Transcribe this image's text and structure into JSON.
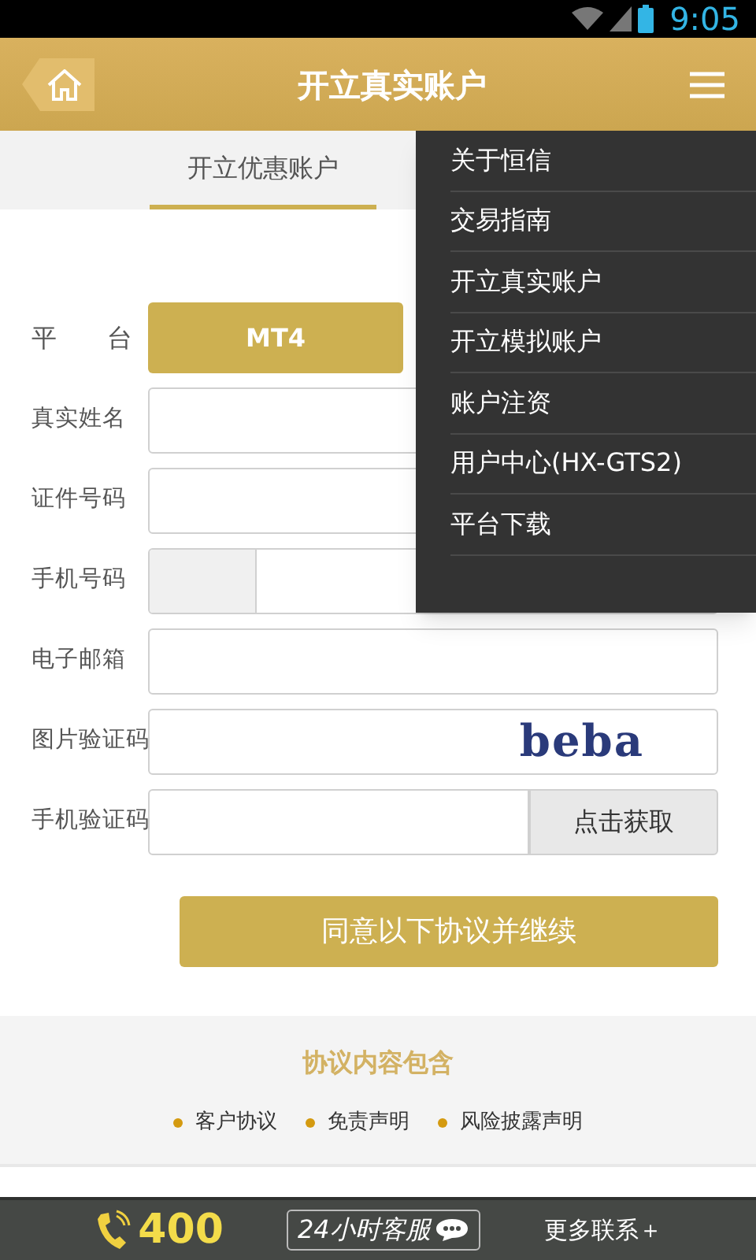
{
  "status_bar": {
    "time": "9:05"
  },
  "header": {
    "title": "开立真实账户"
  },
  "tabs": [
    {
      "label": "开立优惠账户",
      "selected": true
    }
  ],
  "form": {
    "platform": {
      "label": "平　　台",
      "options": [
        {
          "label": "MT4",
          "selected": true
        }
      ]
    },
    "fields": [
      {
        "kind": "text",
        "label": "真实姓名"
      },
      {
        "kind": "text",
        "label": "证件号码"
      },
      {
        "kind": "phone",
        "label": "手机号码"
      },
      {
        "kind": "text",
        "label": "电子邮箱"
      },
      {
        "kind": "captcha",
        "label": "图片验证码",
        "captcha": "beba"
      },
      {
        "kind": "sms",
        "label": "手机验证码",
        "button": "点击获取"
      }
    ],
    "submit": "同意以下协议并继续"
  },
  "agreement": {
    "title": "协议内容包含",
    "items": [
      "客户协议",
      "免责声明",
      "风险披露声明"
    ]
  },
  "footer": {
    "phone": "400",
    "service": "24小时客服",
    "more": "更多联系＋"
  },
  "menu": {
    "items": [
      "关于恒信",
      "交易指南",
      "开立真实账户",
      "开立模拟账户",
      "账户注资",
      "用户中心(HX-GTS2)",
      "平台下载"
    ]
  }
}
